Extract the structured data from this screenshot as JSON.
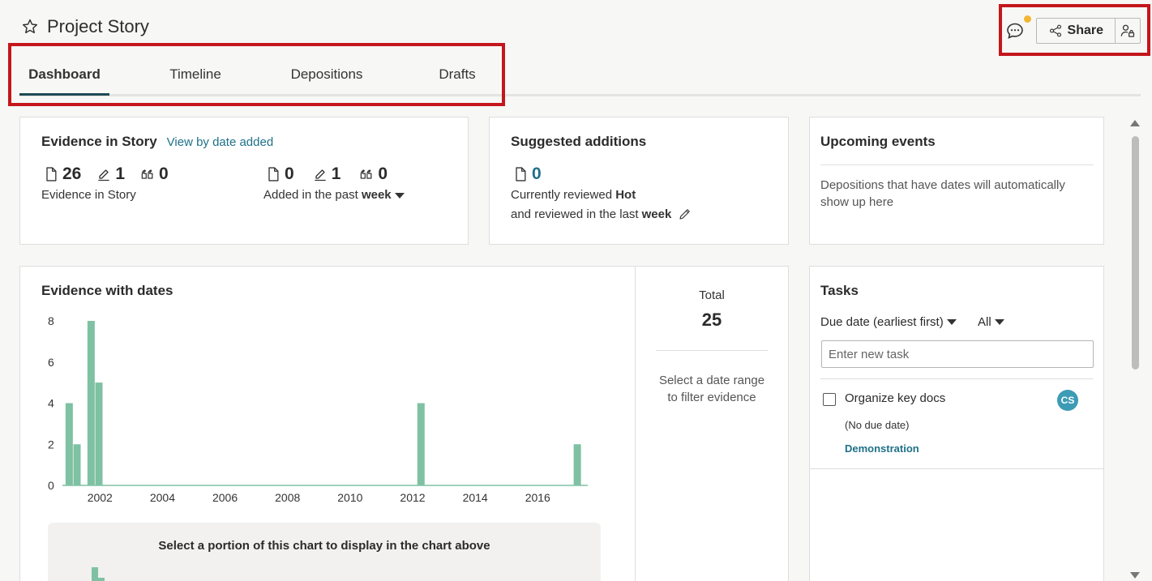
{
  "header": {
    "title": "Project Story",
    "share_label": "Share"
  },
  "tabs": [
    {
      "label": "Dashboard",
      "active": true
    },
    {
      "label": "Timeline",
      "active": false
    },
    {
      "label": "Depositions",
      "active": false
    },
    {
      "label": "Drafts",
      "active": false
    }
  ],
  "evidence_in_story": {
    "title": "Evidence in Story",
    "view_link": "View by date added",
    "in_story": {
      "docs": "26",
      "highlights": "1",
      "quotes": "0",
      "label": "Evidence in Story"
    },
    "added": {
      "docs": "0",
      "highlights": "1",
      "quotes": "0",
      "label_prefix": "Added in the past",
      "period": "week"
    }
  },
  "suggested": {
    "title": "Suggested additions",
    "count": "0",
    "line1_prefix": "Currently reviewed",
    "line1_value": "Hot",
    "line2_prefix": "and reviewed in the last",
    "line2_value": "week"
  },
  "upcoming": {
    "title": "Upcoming events",
    "text": "Depositions that have dates will automatically show up here"
  },
  "evidence_dates": {
    "title": "Evidence with dates",
    "total_label": "Total",
    "total_value": "25",
    "hint": "Select a date range to filter evidence",
    "overview_title": "Select a portion of this chart to display in the chart above"
  },
  "chart_data": {
    "type": "bar",
    "title": "Evidence with dates",
    "y_ticks": [
      "0",
      "2",
      "4",
      "6",
      "8"
    ],
    "ylim": [
      0,
      8
    ],
    "x_ticks": [
      "2002",
      "2004",
      "2006",
      "2008",
      "2010",
      "2012",
      "2014",
      "2016"
    ],
    "xlim": [
      2000.8,
      2017.6
    ],
    "x": [
      2000.9,
      2001.15,
      2001.6,
      2001.85,
      2012.15,
      2017.15
    ],
    "values": [
      4,
      2,
      8,
      5,
      4,
      2
    ],
    "bar_color": "#7fc1a3",
    "grid": false
  },
  "tasks": {
    "title": "Tasks",
    "sort_label": "Due date (earliest first)",
    "filter_label": "All",
    "input_placeholder": "Enter new task",
    "items": [
      {
        "name": "Organize key docs",
        "due": "(No due date)",
        "project": "Demonstration",
        "assignee": "CS"
      }
    ]
  }
}
